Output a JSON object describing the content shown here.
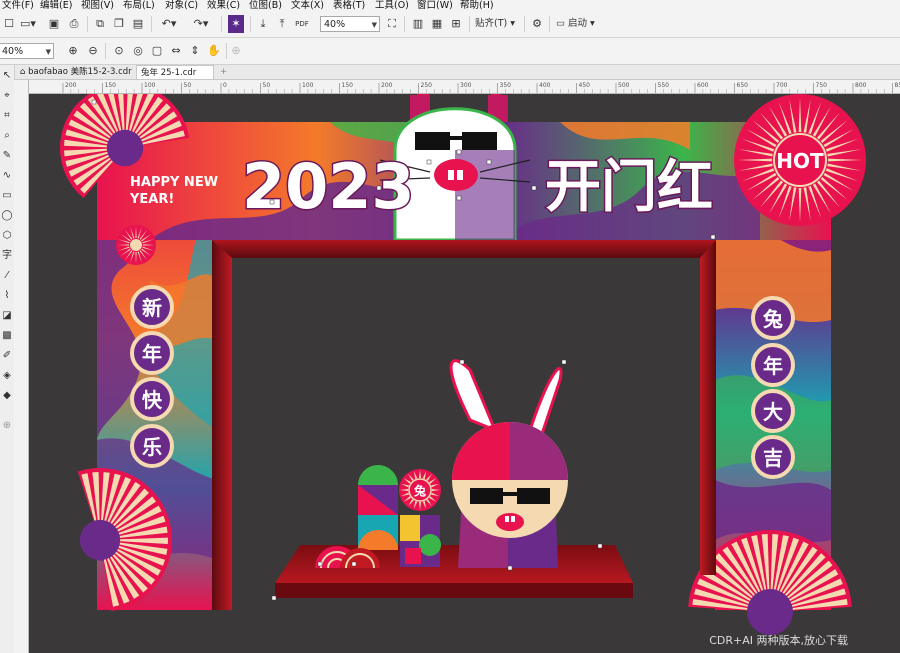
{
  "menu": [
    "文件(F)",
    "编辑(E)",
    "视图(V)",
    "布局(L)",
    "对象(C)",
    "效果(C)",
    "位图(B)",
    "文本(X)",
    "表格(T)",
    "工具(O)",
    "窗口(W)",
    "帮助(H)"
  ],
  "toolbar": {
    "zoom": "40%",
    "snap_label": "贴齐(T)",
    "launch_label": "启动"
  },
  "property_bar": {
    "zoom": "40%"
  },
  "tabs": [
    {
      "label": "baofabao 美陈15-2-3.cdr",
      "active": false
    },
    {
      "label": "兔年 25-1.cdr",
      "active": true
    }
  ],
  "ruler": {
    "ticks": [
      "200",
      "150",
      "100",
      "50",
      "0",
      "50",
      "100",
      "150",
      "200",
      "250",
      "300",
      "350",
      "400",
      "450",
      "500",
      "550",
      "600",
      "650",
      "700",
      "750",
      "800",
      "850"
    ]
  },
  "artwork": {
    "year": "2023",
    "headline": "开门红",
    "greeting_line1": "HAPPY NEW",
    "greeting_line2": "YEAR!",
    "badge": "HOT",
    "left_chars": [
      "新",
      "年",
      "快",
      "乐"
    ],
    "right_chars": [
      "兔",
      "年",
      "大",
      "吉"
    ],
    "small_badge": "兔"
  },
  "watermark": "CDR+AI 两种版本,放心下载",
  "colors": {
    "canvas": "#3a3838",
    "magenta": "#e8124f",
    "purple": "#6a2a8a",
    "cream": "#f4d9b1",
    "dark_red": "#8a0e14"
  }
}
